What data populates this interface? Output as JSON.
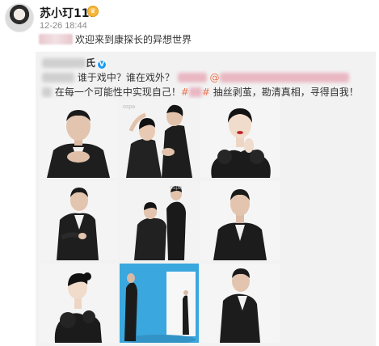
{
  "post": {
    "username": "苏小玎117",
    "vip_badge_icon": "crown-badge-icon",
    "timestamp": "12-26 18:44",
    "text": "欢迎来到康探长的异想世界"
  },
  "repost": {
    "author_verified_icon": "verified-v-icon",
    "author_suffix": "氏",
    "text_line1_a": "谁于戏中？谁在戏外？",
    "text_line1_b": "@",
    "text_line2_a": "在每一个可能性中实现自己！",
    "text_line2_b": "#",
    "text_line2_c": "抽丝剥茧，勘清真相，寻得自我！",
    "watermark": "ospa"
  },
  "colors": {
    "link": "#eb7350",
    "repost_bg": "#f2f2f2",
    "verified": "#1d9bf0"
  },
  "photos": [
    {
      "label": "man in black suit, hands folded",
      "bg": "#f4f4f4"
    },
    {
      "label": "couple posing with hands",
      "bg": "#f3f3f3"
    },
    {
      "label": "woman with red lips, ruffled black top",
      "bg": "#f5f5f5"
    },
    {
      "label": "man standing in black suit",
      "bg": "#f4f4f4"
    },
    {
      "label": "couple standing back to back",
      "bg": "#f3f3f3"
    },
    {
      "label": "man in suit, half body",
      "bg": "#f5f5f5"
    },
    {
      "label": "woman in black ruffle dress",
      "bg": "#f4f4f4"
    },
    {
      "label": "man in blue studio with door",
      "bg": "#3aa7de"
    },
    {
      "label": "man in suit turning",
      "bg": "#f5f5f5"
    }
  ]
}
